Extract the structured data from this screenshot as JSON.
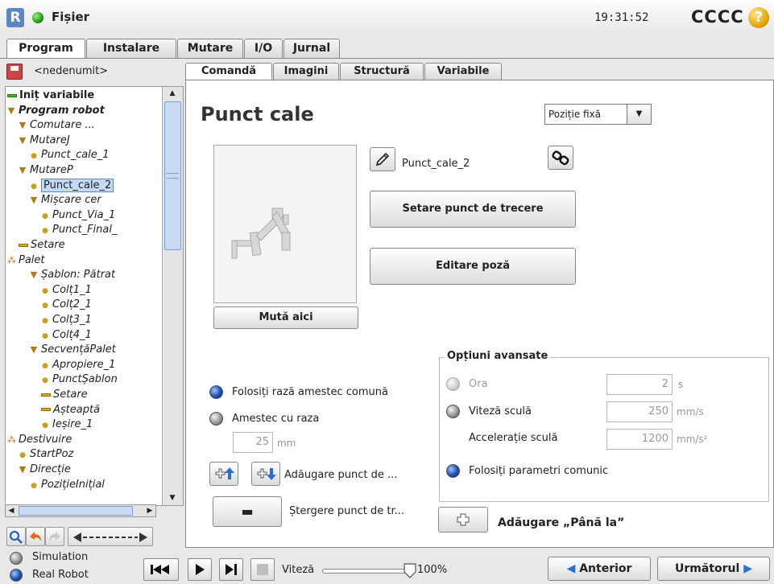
{
  "titlebar": {
    "file_menu": "Fișier",
    "clock": "19:31:52",
    "robot_name": "CCCC",
    "help": "?"
  },
  "top_tabs": [
    "Program",
    "Instalare",
    "Mutare",
    "I/O",
    "Jurnal"
  ],
  "program": {
    "name": "<nedenumit>"
  },
  "tree": [
    {
      "label": "Inițiere variabile",
      "display": "Iniț variabile",
      "marker": "bar-green",
      "style": "plain-bold"
    },
    {
      "label": "Program robot",
      "marker": "triangle",
      "style": "bold"
    },
    {
      "label": "Comutare ...",
      "marker": "triangle"
    },
    {
      "label": "MutareJ",
      "marker": "triangle"
    },
    {
      "label": "Punct_cale_1",
      "marker": "dot"
    },
    {
      "label": "MutareP",
      "marker": "triangle"
    },
    {
      "label": "Punct_cale_2",
      "marker": "dot",
      "selected": true
    },
    {
      "label": "Mișcare cer",
      "marker": "triangle"
    },
    {
      "label": "Punct_Via_1",
      "marker": "dot"
    },
    {
      "label": "Punct_Final_",
      "marker": "dot"
    },
    {
      "label": "Setare",
      "marker": "bar"
    },
    {
      "label": "Palet",
      "marker": "cluster"
    },
    {
      "label": "Șablon: Pătrat",
      "marker": "triangle"
    },
    {
      "label": "Colț1_1",
      "marker": "dot"
    },
    {
      "label": "Colț2_1",
      "marker": "dot"
    },
    {
      "label": "Colț3_1",
      "marker": "dot"
    },
    {
      "label": "Colț4_1",
      "marker": "dot"
    },
    {
      "label": "SecvențăPalet",
      "marker": "triangle"
    },
    {
      "label": "Apropiere_1",
      "marker": "dot"
    },
    {
      "label": "PunctȘablon",
      "marker": "dot"
    },
    {
      "label": "Setare",
      "marker": "bar"
    },
    {
      "label": "Așteaptă",
      "marker": "bar"
    },
    {
      "label": "Ieșire_1",
      "marker": "dot"
    },
    {
      "label": "Destivuire",
      "marker": "cluster"
    },
    {
      "label": "StartPoz",
      "marker": "dot"
    },
    {
      "label": "Direcție",
      "marker": "triangle"
    },
    {
      "label": "PozițieInițial",
      "marker": "dot"
    }
  ],
  "sub_tabs": [
    "Comandă",
    "Imagini",
    "Structură",
    "Variabile"
  ],
  "command": {
    "title": "Punct cale",
    "position_type": "Poziție fixă",
    "waypoint_name": "Punct_cale_2",
    "set_waypoint": "Setare punct de trecere",
    "edit_pose": "Editare poză",
    "move_here": "Mută aici",
    "shared_blend": "Folosiți rază amestec comună",
    "blend_with_radius": "Amestec cu raza",
    "blend_radius_value": "25",
    "blend_radius_unit": "mm",
    "add_waypoint": "Adăugare punct de ...",
    "delete_waypoint": "Ștergere punct de tr...",
    "add_until": "Adăugare „Până la”"
  },
  "advanced": {
    "title": "Opțiuni avansate",
    "time_label": "Ora",
    "time_value": "2",
    "time_unit": "s",
    "tool_speed_label": "Viteză sculă",
    "tool_speed_value": "250",
    "tool_speed_unit": "mm/s",
    "tool_accel_label": "Accelerație sculă",
    "tool_accel_value": "1200",
    "tool_accel_unit": "mm/s²",
    "shared_params": "Folosiți parametri comunic"
  },
  "footer": {
    "simulation": "Simulation",
    "real_robot": "Real Robot",
    "speed_label": "Viteză",
    "speed_value": "100%",
    "speed_fraction": 1.0,
    "previous": "Anterior",
    "next": "Următorul"
  },
  "colors": {
    "accent": "#5b86c9",
    "selection": "#c6d9f4",
    "status_green": "#1f9a12",
    "help_yellow": "#e2a400"
  }
}
